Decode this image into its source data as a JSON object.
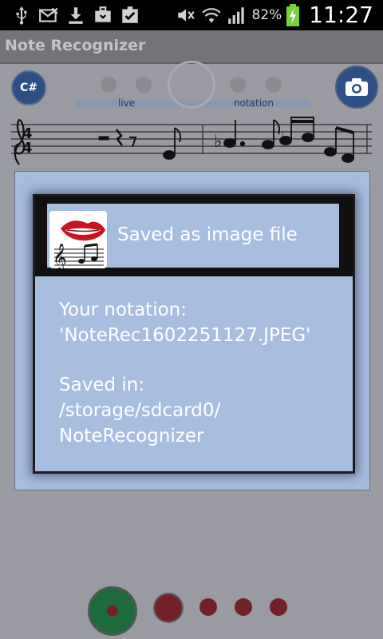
{
  "status_bar": {
    "battery_percent": "82%",
    "time": "11:27",
    "left_icons": [
      "usb-icon",
      "missed-mail-icon",
      "download-icon",
      "briefcase-icon",
      "checklist-icon"
    ],
    "right_icons": [
      "mute-icon",
      "wifi-icon",
      "signal-icon",
      "battery-charging-icon"
    ]
  },
  "app": {
    "title": "Note Recognizer",
    "key_button": "C#",
    "mode_live": "live",
    "mode_notation": "notation",
    "time_signature_top": "4",
    "time_signature_bottom": "4"
  },
  "dialog": {
    "title": "Saved as image file",
    "line1": "Your notation:",
    "line2": "'NoteRec1602251127.JPEG'",
    "line3": "Saved in:",
    "line4": "/storage/sdcard0/",
    "line5": "NoteRecognizer"
  },
  "colors": {
    "dialog_bg": "#a7bde0",
    "accent_blue": "#2e4f86",
    "record_green": "#1d6b3c"
  }
}
